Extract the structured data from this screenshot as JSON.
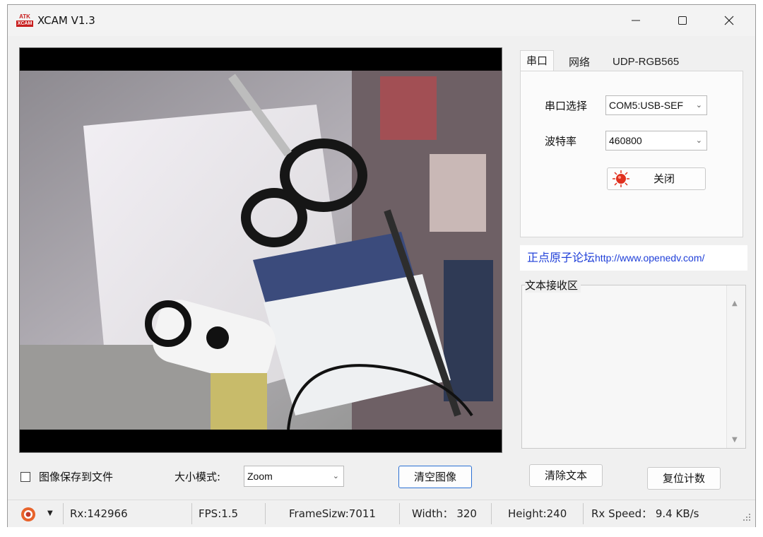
{
  "window": {
    "title": "XCAM V1.3",
    "logo_text": "ATK XCAM"
  },
  "tabs": [
    {
      "label": "串口",
      "active": true
    },
    {
      "label": "网络",
      "active": false
    },
    {
      "label": "UDP-RGB565",
      "active": false
    }
  ],
  "serial": {
    "port_label": "串口选择",
    "port_value": "COM5:USB-SEF",
    "baud_label": "波特率",
    "baud_value": "460800",
    "close_button": "关闭"
  },
  "link": {
    "brand": "正点原子论坛",
    "url": "http://www.openedv.com/"
  },
  "receive": {
    "label": "文本接收区",
    "content": ""
  },
  "controls": {
    "save_checkbox_label": "图像保存到文件",
    "save_checked": false,
    "size_mode_label": "大小模式:",
    "size_mode_value": "Zoom",
    "clear_image_button": "清空图像",
    "clear_text_button": "清除文本",
    "reset_count_button": "复位计数"
  },
  "status": {
    "rx": "Rx:142966",
    "fps": "FPS:1.5",
    "frame_size": "FrameSizw:7011",
    "width": "Width： 320",
    "height": "Height:240",
    "rx_speed": "Rx Speed： 9.4 KB/s"
  },
  "colors": {
    "accent_link": "#1f3fd8",
    "status_red": "#e0301e",
    "window_bg": "#f0f0f0"
  }
}
